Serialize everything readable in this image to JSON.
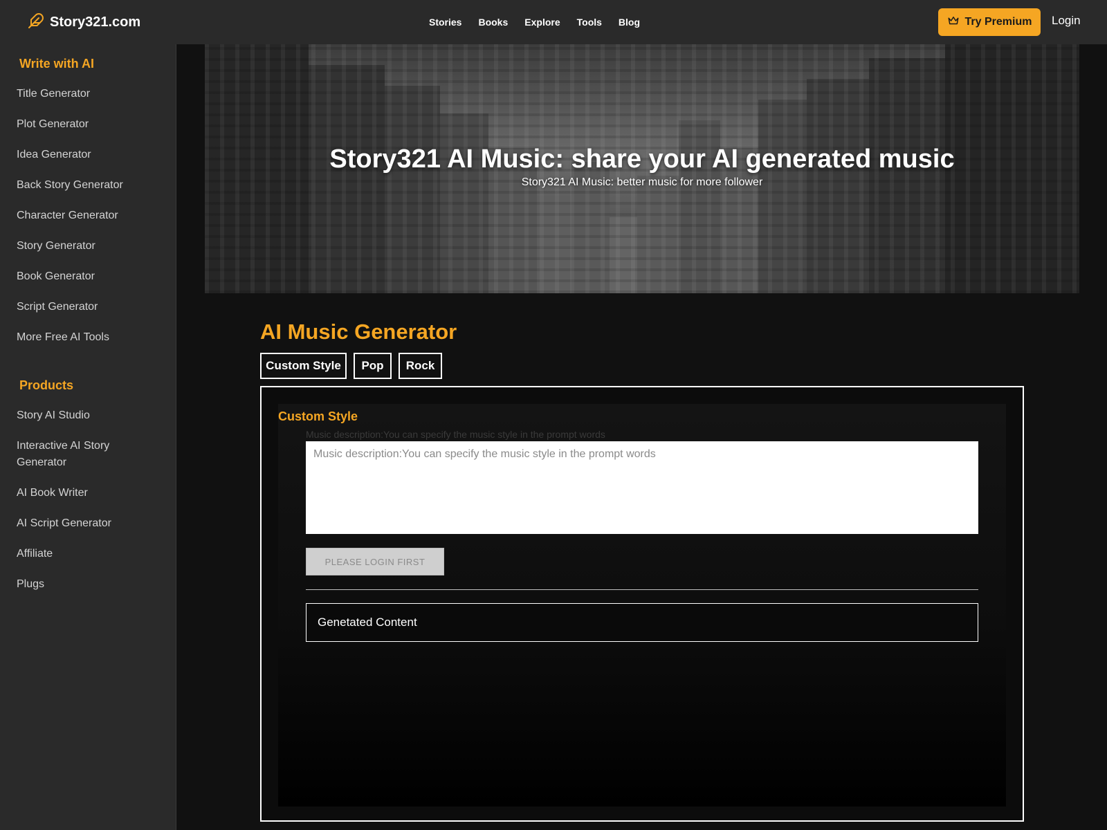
{
  "brand": {
    "name": "Story321.com",
    "icon": "feather-icon",
    "accent_color": "#f5a623"
  },
  "nav": {
    "items": [
      "Stories",
      "Books",
      "Explore",
      "Tools",
      "Blog"
    ]
  },
  "header": {
    "premium_label": "Try Premium",
    "premium_icon": "crown-icon",
    "login_label": "Login"
  },
  "sidebar": {
    "write_heading": "Write with AI",
    "write_items": [
      "Title Generator",
      "Plot Generator",
      "Idea Generator",
      "Back Story Generator",
      "Character Generator",
      "Story Generator",
      "Book Generator",
      "Script Generator",
      "More Free AI Tools"
    ],
    "products_heading": "Products",
    "product_items": [
      "Story AI Studio",
      "Interactive AI Story Generator",
      "AI Book Writer",
      "AI Script Generator",
      "Affiliate",
      "Plugs"
    ]
  },
  "hero": {
    "title": "Story321 AI Music: share your AI generated music",
    "subtitle": "Story321 AI Music: better music for more follower"
  },
  "generator": {
    "title": "AI Music Generator",
    "tabs": [
      "Custom Style",
      "Pop",
      "Rock"
    ],
    "panel_title": "Custom Style",
    "field_label": "Music description:You can specify the music style in the prompt words",
    "field_placeholder": "Music description:You can specify the music style in the prompt words",
    "field_value": "",
    "submit_label": "PLEASE LOGIN FIRST",
    "output_label": "Genetated Content"
  }
}
